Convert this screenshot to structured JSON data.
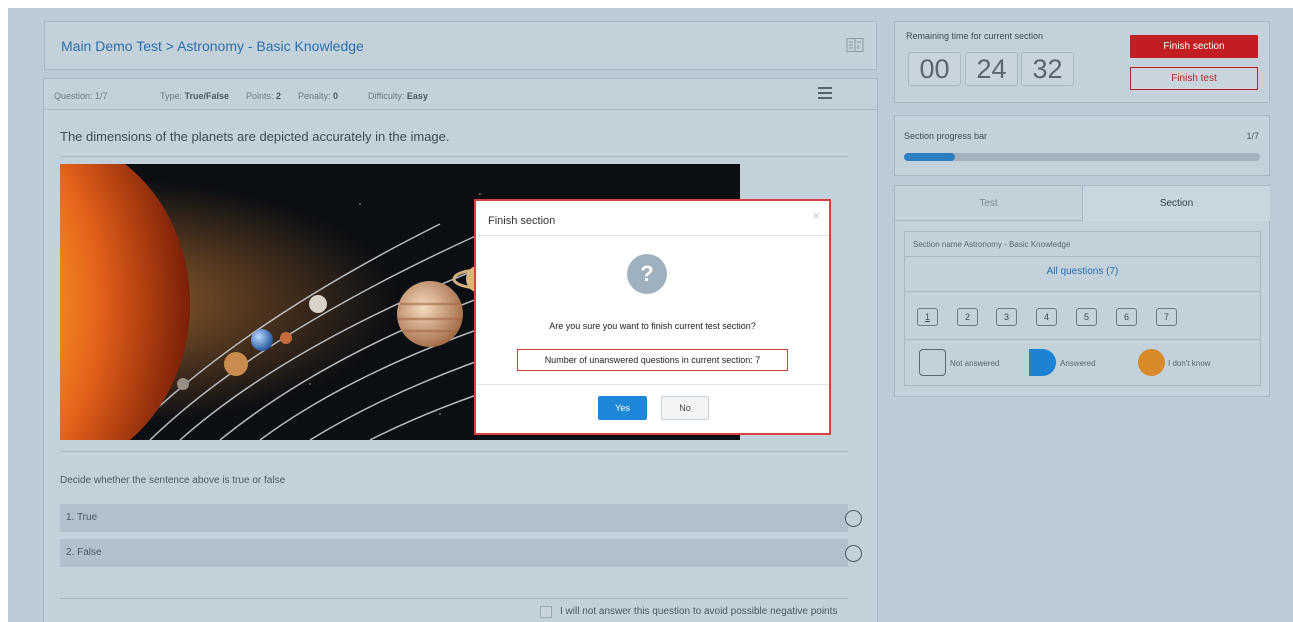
{
  "header": {
    "breadcrumb": "Main Demo Test > Astronomy - Basic Knowledge"
  },
  "question_meta": {
    "question_label": "Question:",
    "question_value": "1/7",
    "type_label": "Type:",
    "type_value": "True/False",
    "points_label": "Points:",
    "points_value": "2",
    "penalty_label": "Penalty:",
    "penalty_value": "0",
    "difficulty_label": "Difficulty:",
    "difficulty_value": "Easy"
  },
  "question": {
    "text": "The dimensions of the planets are depicted accurately in the image.",
    "instruction": "Decide whether the sentence above is true or false",
    "options": [
      {
        "label": "1. True"
      },
      {
        "label": "2. False"
      }
    ],
    "no_answer_label": "I will not answer this question to avoid possible negative points"
  },
  "timer": {
    "label": "Remaining time for current section",
    "hours": "00",
    "minutes": "24",
    "seconds": "32",
    "finish_section_label": "Finish section",
    "finish_test_label": "Finish test"
  },
  "progress": {
    "label": "Section progress bar",
    "count": "1/7",
    "fraction": 0.143
  },
  "navigator": {
    "tabs": [
      "Test",
      "Section"
    ],
    "active_tab": "Section",
    "section_name": "Section name Astronomy - Basic Knowledge",
    "all_questions_label": "All questions (7)",
    "question_numbers": [
      "1",
      "2",
      "3",
      "4",
      "5",
      "6",
      "7"
    ],
    "current_question": "1",
    "legend": {
      "not_answered": "Not answered",
      "answered": "Answered",
      "dont_know": "I don't know"
    }
  },
  "dialog": {
    "title": "Finish section",
    "close_glyph": "×",
    "icon_glyph": "?",
    "message": "Are you sure you want to finish current test section?",
    "unanswered_text": "Number of unanswered questions in current section: 7",
    "yes_label": "Yes",
    "no_label": "No"
  },
  "colors": {
    "accent_blue": "#2c7dc1",
    "danger_red": "#c21d23",
    "answered_blue": "#1e82d2",
    "dont_know_orange": "#d88a2a"
  }
}
